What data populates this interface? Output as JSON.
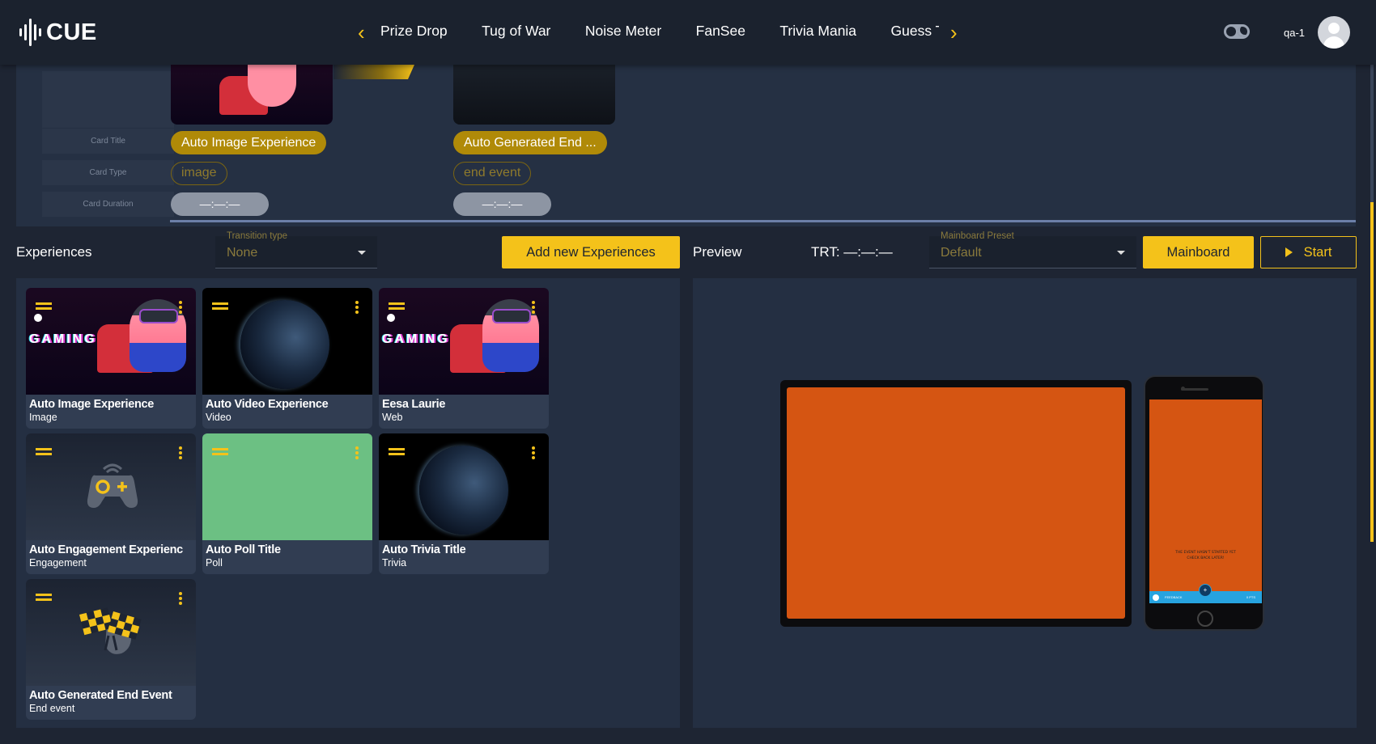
{
  "header": {
    "logo_text": "CUE",
    "nav_items": [
      "Prize Drop",
      "Tug of War",
      "Noise Meter",
      "FanSee",
      "Trivia Mania",
      "Guess T"
    ],
    "user_name": "qa-1"
  },
  "timeline": {
    "row_labels": [
      "Card Title",
      "Card Type",
      "Card Duration"
    ],
    "cards": [
      {
        "title": "Auto Image Experience",
        "type": "image",
        "duration": "—:—:—"
      },
      {
        "title": "Auto Generated End ...",
        "type": "end event",
        "duration": "—:—:—"
      }
    ]
  },
  "toolbar": {
    "experiences_label": "Experiences",
    "transition_label": "Transition type",
    "transition_value": "None",
    "add_button": "Add new Experiences",
    "preview_label": "Preview",
    "trt_text": "TRT: —:—:—",
    "preset_label": "Mainboard Preset",
    "preset_value": "Default",
    "mainboard_button": "Mainboard",
    "start_button": "Start"
  },
  "experiences": [
    {
      "name": "Auto Image Experience",
      "type": "Image",
      "thumb": "gaming"
    },
    {
      "name": "Auto Video Experience",
      "type": "Video",
      "thumb": "space"
    },
    {
      "name": "Eesa Laurie",
      "type": "Web",
      "thumb": "gaming"
    },
    {
      "name": "Auto Engagement Experienc",
      "type": "Engagement",
      "thumb": "gamepad-icon"
    },
    {
      "name": "Auto Poll Title",
      "type": "Poll",
      "thumb": "poll"
    },
    {
      "name": "Auto Trivia Title",
      "type": "Trivia",
      "thumb": "space"
    },
    {
      "name": "Auto Generated End Event",
      "type": "End event",
      "thumb": "race-flags-icon"
    }
  ],
  "preview": {
    "screen_color": "#d55512",
    "phone_message_line1": "THE EVENT HASN'T STARTED YET",
    "phone_message_line2": "CHECK BACK LATER!",
    "phone_bar_left": "FEEDBACK",
    "phone_bar_right": "0 PTS"
  },
  "colors": {
    "accent": "#f4c21a",
    "background": "#1e2533",
    "panel": "#242f42"
  }
}
